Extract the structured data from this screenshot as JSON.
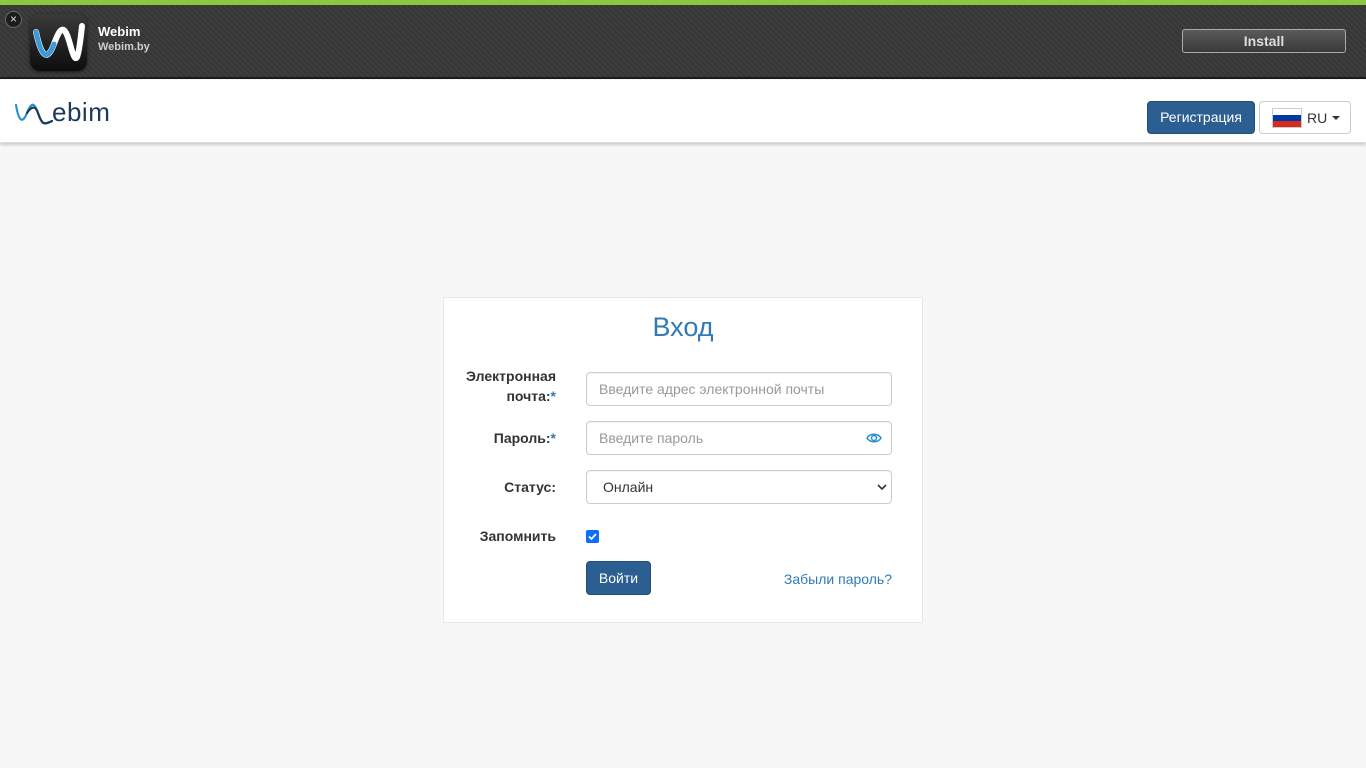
{
  "banner": {
    "app_name": "Webim",
    "app_domain": "Webim.by",
    "install_label": "Install",
    "close_symbol": "×",
    "accent_color": "#8dc63f"
  },
  "navbar": {
    "logo_text": "ebim",
    "register_label": "Регистрация",
    "language": {
      "code": "RU",
      "flag_colors": [
        "#ffffff",
        "#0039a6",
        "#d52b1e"
      ]
    }
  },
  "login": {
    "title": "Вход",
    "email_label": "Электронная почта:",
    "email_label_line1": "Электронная",
    "email_label_line2": "почта:",
    "email_placeholder": "Введите адрес электронной почты",
    "password_label": "Пароль:",
    "password_placeholder": "Введите пароль",
    "status_label": "Статус:",
    "status_value": "Онлайн",
    "remember_label": "Запомнить",
    "remember_checked": true,
    "required_mark": "*",
    "submit_label": "Войти",
    "forgot_label": "Забыли пароль?"
  },
  "icons": {
    "banner_close": "close-icon",
    "password_toggle": "eye-icon",
    "status_dropdown": "chevron-down-icon",
    "language_dropdown": "caret-down-icon"
  }
}
